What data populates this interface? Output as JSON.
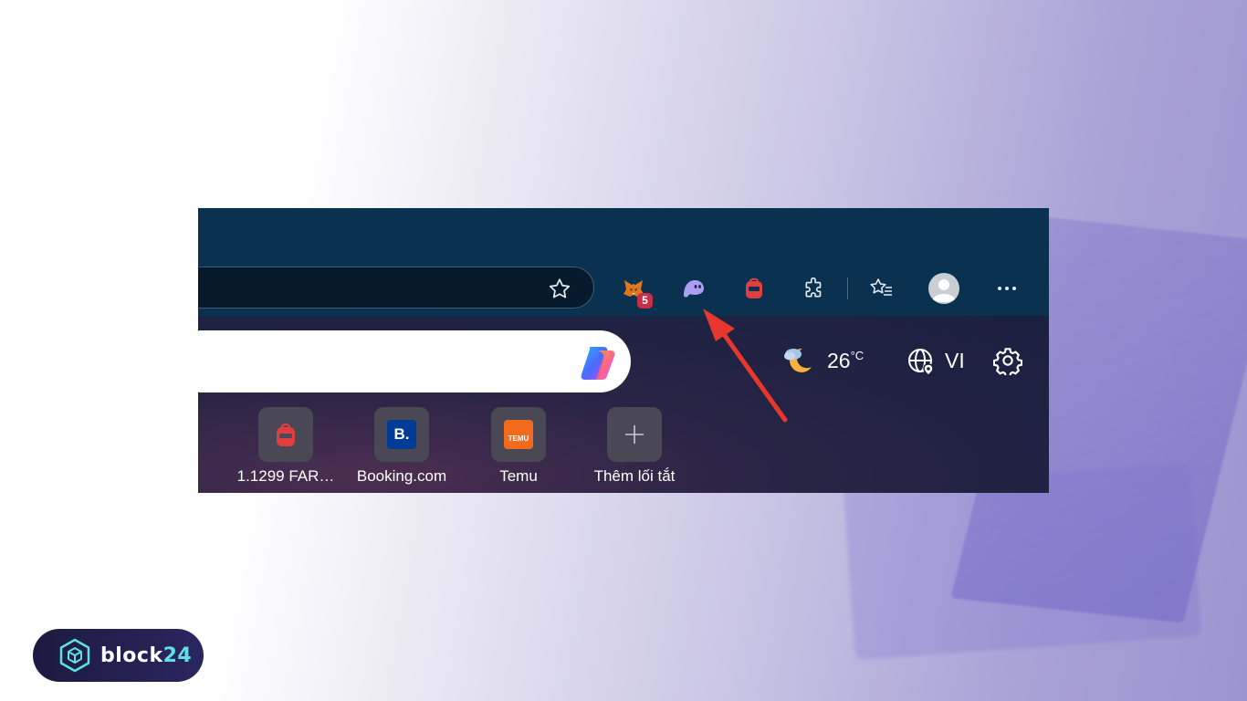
{
  "toolbar": {
    "extension_badge_count": "5",
    "icons": [
      "star-icon",
      "metamask-fox-icon",
      "phantom-ghost-icon",
      "backpack-icon",
      "extensions-puzzle-icon",
      "favorites-icon",
      "profile-avatar-icon",
      "more-menu-icon"
    ]
  },
  "newtab": {
    "weather": {
      "temperature": "26",
      "unit": "°C"
    },
    "language": "VI",
    "shortcuts": [
      {
        "label": "1.1299 FAR…",
        "icon": "backpack-icon"
      },
      {
        "label": "Booking.com",
        "icon": "booking-icon",
        "icon_text": "B."
      },
      {
        "label": "Temu",
        "icon": "temu-icon",
        "icon_text": "TEMU"
      },
      {
        "label": "Thêm lối tắt",
        "icon": "plus-icon"
      }
    ]
  },
  "brand": {
    "name_main": "block",
    "name_accent": "24"
  },
  "colors": {
    "toolbar_bg": "#0b3150",
    "arrow": "#e8372c",
    "badge": "#c62f47",
    "phantom": "#ab9ff2",
    "backpack": "#e33e3f",
    "temu": "#f26b1d",
    "booking": "#003b95"
  }
}
